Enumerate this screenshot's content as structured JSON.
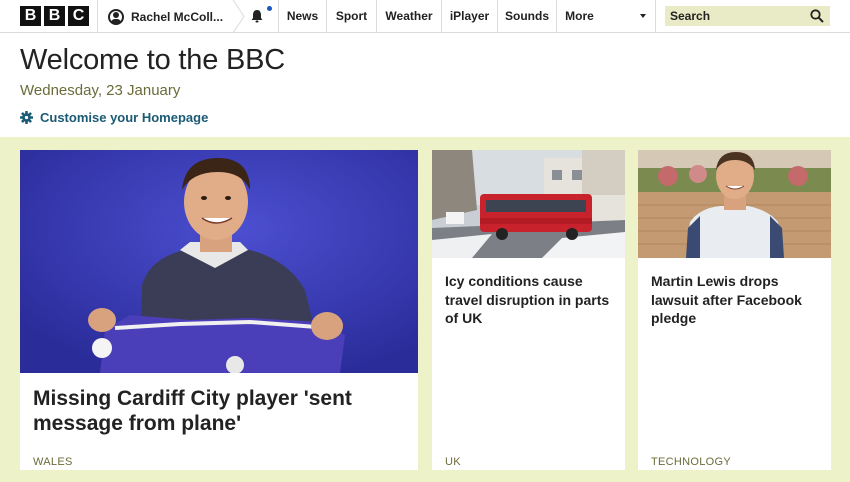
{
  "nav": {
    "logo_letters": [
      "B",
      "B",
      "C"
    ],
    "account_name": "Rachel McColl...",
    "items": [
      "News",
      "Sport",
      "Weather",
      "iPlayer",
      "Sounds",
      "More"
    ],
    "search_placeholder": "Search"
  },
  "header": {
    "title": "Welcome to the BBC",
    "date": "Wednesday, 23 January",
    "customise_label": "Customise your Homepage"
  },
  "stories": [
    {
      "headline": "Missing Cardiff City player 'sent message from plane'",
      "tag": "WALES"
    },
    {
      "headline": "Icy conditions cause travel disruption in parts of UK",
      "tag": "UK"
    },
    {
      "headline": "Martin Lewis drops lawsuit after Facebook pledge",
      "tag": "TECHNOLOGY"
    }
  ],
  "colors": {
    "accent_band": "#eef2c8",
    "link": "#1a5a75",
    "search_bg": "#e8ebc6",
    "notification_dot": "#1a56c4"
  }
}
